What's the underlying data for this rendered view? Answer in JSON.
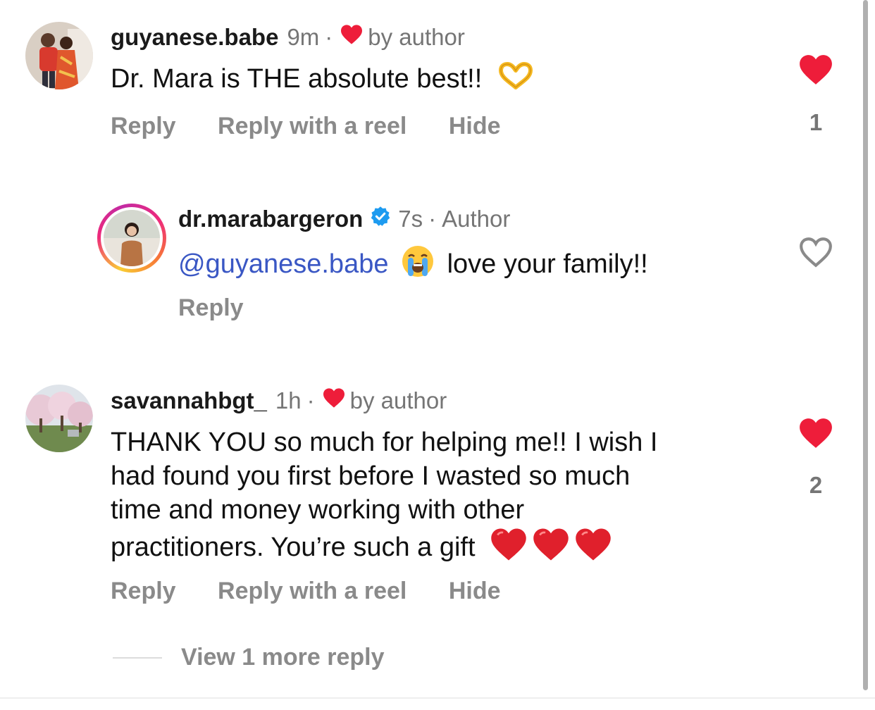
{
  "comments": [
    {
      "username": "guyanese.babe",
      "time": "9m",
      "separator": "·",
      "liked_label": "by author",
      "text": "Dr. Mara is THE absolute best!!",
      "text_emoji": "heart-hands-emoji",
      "actions": {
        "reply": "Reply",
        "reply_reel": "Reply with a reel",
        "hide": "Hide"
      },
      "likes": "1",
      "liked": true
    },
    {
      "username": "dr.marabargeron",
      "verified": true,
      "time": "7s",
      "separator": "·",
      "author_label": "Author",
      "mention": "@guyanese.babe",
      "text_emoji": "crying-face-emoji",
      "text": "love your family!!",
      "actions": {
        "reply": "Reply"
      },
      "liked": false
    },
    {
      "username": "savannahbgt_",
      "time": "1h",
      "separator": "·",
      "liked_label": "by author",
      "text_lines": [
        "THANK YOU so much for helping me!! I wish I",
        "had found you first before I wasted so much",
        "time and money working with other",
        "practitioners. You’re such a gift"
      ],
      "text_emoji": "red-heart-emoji",
      "actions": {
        "reply": "Reply",
        "reply_reel": "Reply with a reel",
        "hide": "Hide"
      },
      "likes": "2",
      "liked": true
    }
  ],
  "view_more": "View 1 more reply",
  "colors": {
    "heart_red": "#ee1d3a",
    "mention_blue": "#3a57c4",
    "meta_gray": "#757575",
    "action_gray": "#8a8a8a",
    "verified_blue": "#1d9bf0"
  }
}
